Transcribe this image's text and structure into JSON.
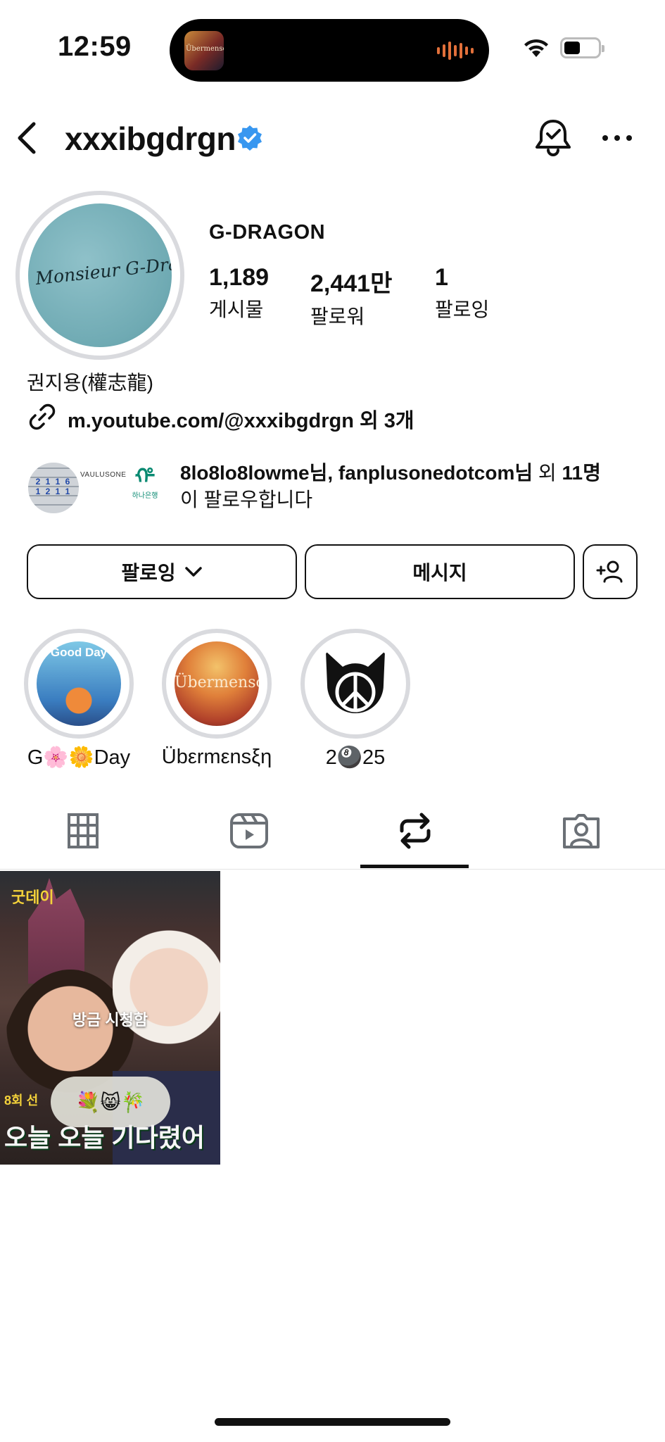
{
  "status_bar": {
    "time": "12:59",
    "now_playing_art_text": "Übermensch"
  },
  "header": {
    "username": "xxxibgdrgn",
    "verified": true,
    "accent_color": "#3897f0"
  },
  "profile": {
    "display_name": "G-DRAGON",
    "avatar_text": "Monsieur G-Dragon",
    "stats": [
      {
        "value": "1,189",
        "label": "게시물"
      },
      {
        "value": "2,441만",
        "label": "팔로워"
      },
      {
        "value": "1",
        "label": "팔로잉"
      }
    ],
    "bio_name": "권지용(權志龍)",
    "link": "m.youtube.com/@xxxibgdrgn 외 3개"
  },
  "followed_by": {
    "names": "8lo8lo8lowme님, fanplusonedotcom님",
    "suffix": "외",
    "count": "11명",
    "line2": "이 팔로우합니다",
    "avatar_texts": [
      "VAULUSONE",
      "하나은행"
    ]
  },
  "buttons": {
    "following": "팔로잉",
    "message": "메시지"
  },
  "highlights": [
    {
      "label": "G🌸🌼Day",
      "cover_text": "Good Day"
    },
    {
      "label": "Übεrmεnsξη",
      "cover_text": "Übermensch"
    },
    {
      "label": "2🎱25"
    }
  ],
  "tabs": [
    {
      "name": "grid",
      "icon": "grid-icon",
      "active": false
    },
    {
      "name": "reels",
      "icon": "reels-icon",
      "active": false
    },
    {
      "name": "reposts",
      "icon": "repost-icon",
      "active": true
    },
    {
      "name": "tagged",
      "icon": "tagged-icon",
      "active": false
    }
  ],
  "posts": [
    {
      "caption": "방금 시청함",
      "top_badge": "굿데이",
      "episode": "8회 선",
      "subtitle": "오늘 오늘 기다렸어",
      "sticker": "💐😸🎋"
    }
  ]
}
